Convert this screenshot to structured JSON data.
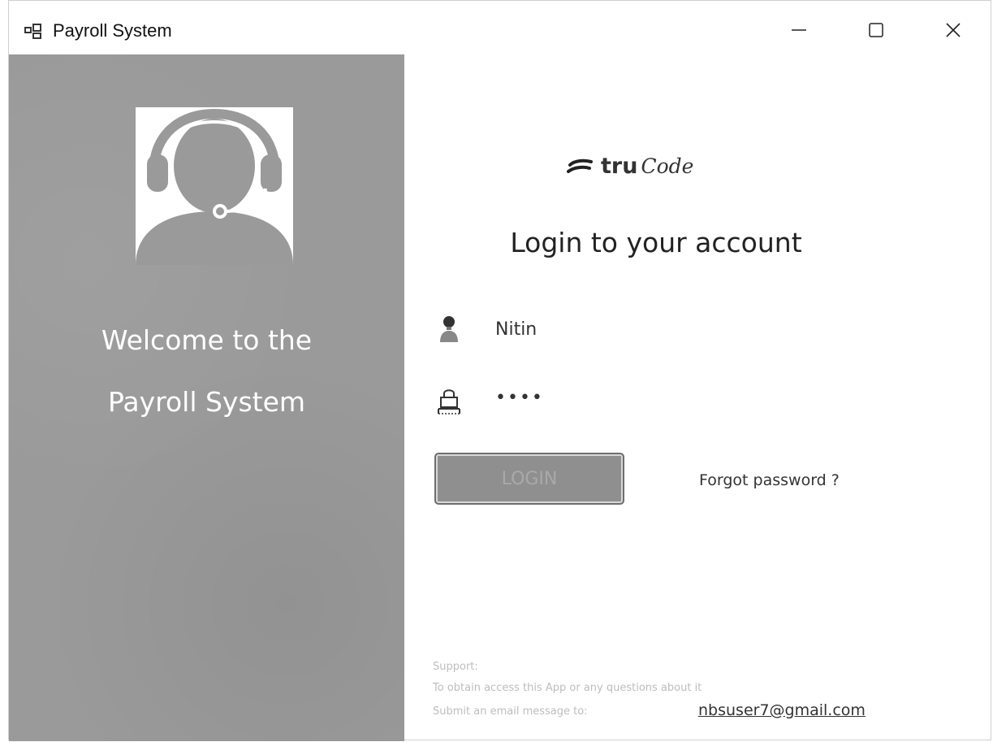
{
  "window": {
    "title": "Payroll System"
  },
  "left": {
    "welcome_line1": "Welcome to the",
    "welcome_line2": "Payroll System"
  },
  "logo": {
    "part1": "tru",
    "part2": "Code"
  },
  "login": {
    "heading": "Login to your account",
    "username": "Nitin",
    "password": "••••",
    "button_label": "LOGIN",
    "forgot_label": "Forgot password ?"
  },
  "support": {
    "title": "Support:",
    "line1": "To obtain access this App or any questions about it",
    "line2": "Submit an email message to:",
    "email": "nbsuser7@gmail.com"
  },
  "icons": {
    "app": "app-window-icon",
    "avatar": "headset-support-person-icon",
    "user": "user-icon",
    "password": "lock-icon",
    "logo": "trucode-logo-mark"
  }
}
